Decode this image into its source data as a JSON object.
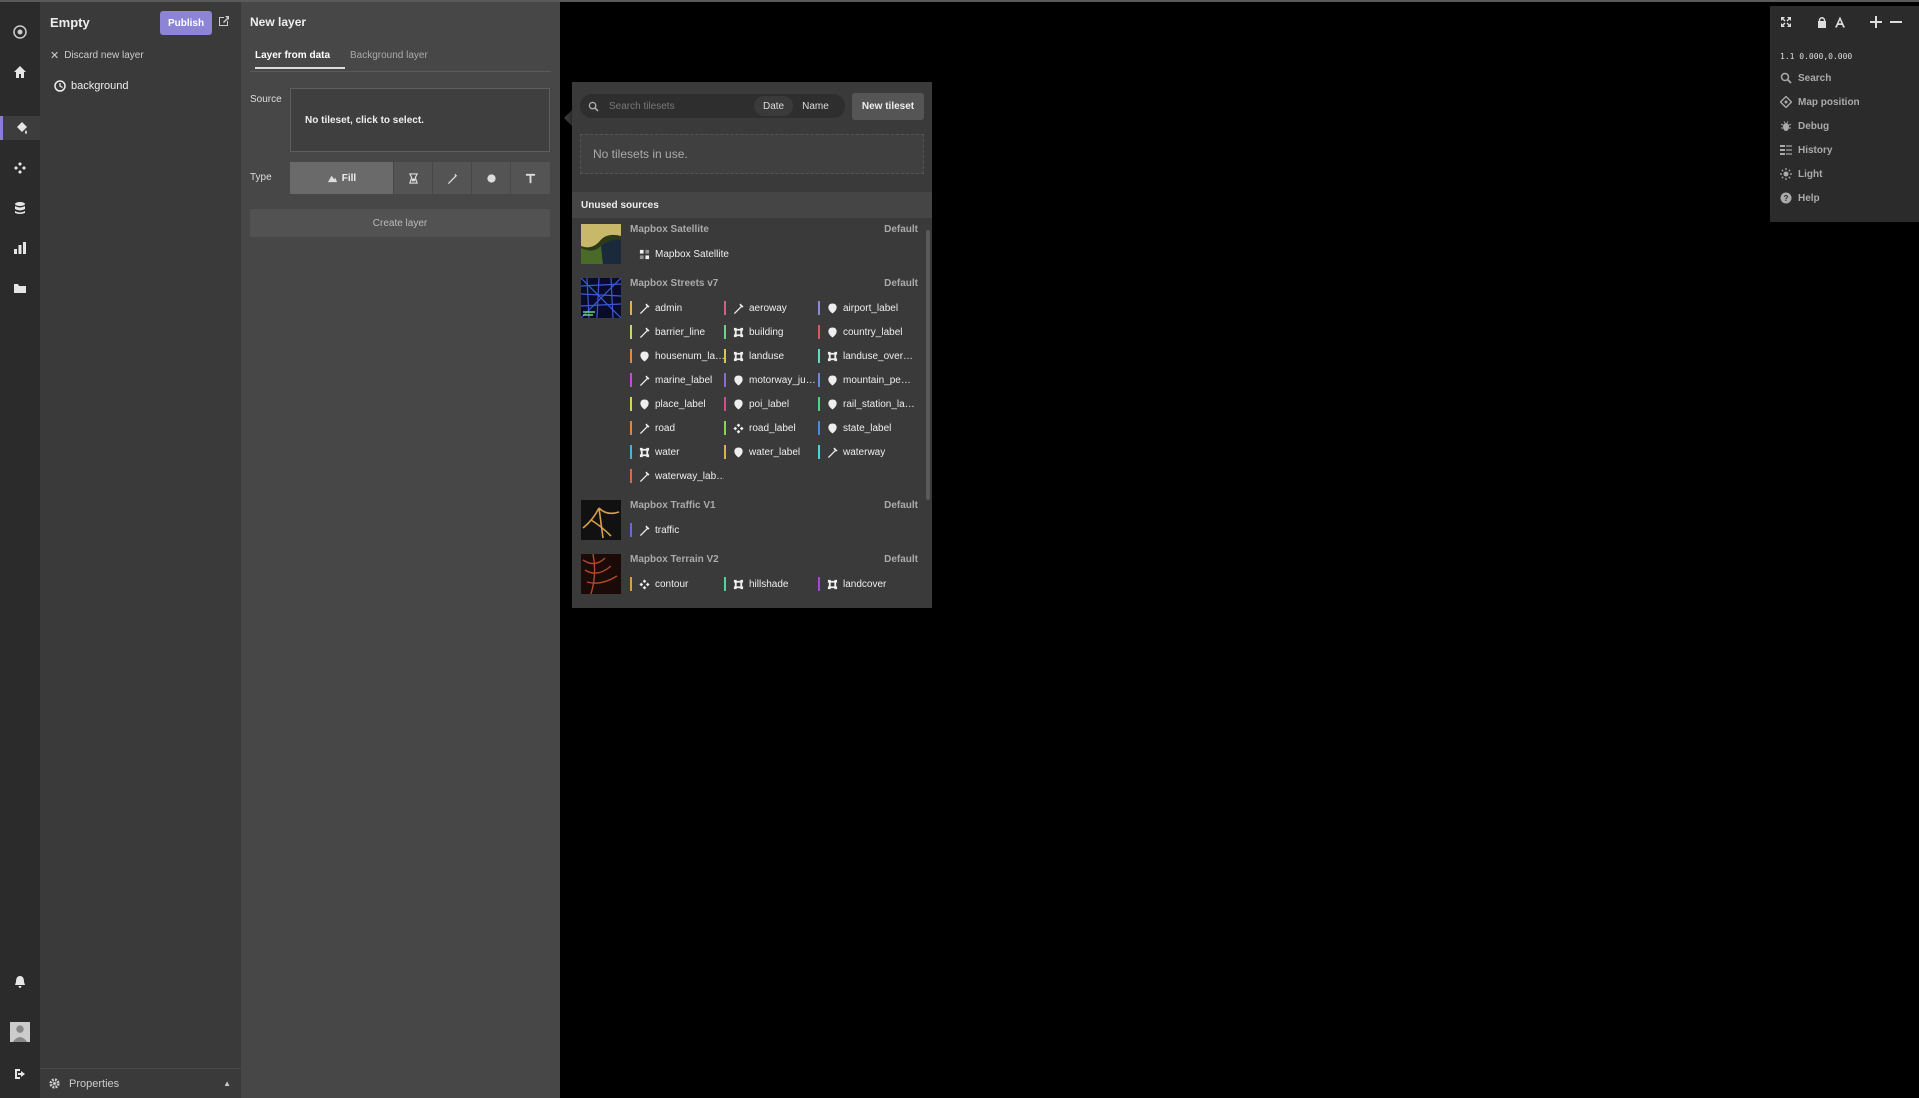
{
  "app": {
    "style_name": "Empty",
    "publish_label": "Publish"
  },
  "layers_panel": {
    "discard_label": "Discard new layer",
    "layers": [
      {
        "name": "background"
      }
    ],
    "properties_label": "Properties"
  },
  "new_layer": {
    "title": "New layer",
    "tabs": [
      {
        "label": "Layer from data",
        "active": true
      },
      {
        "label": "Background layer",
        "active": false
      }
    ],
    "source_label": "Source",
    "source_value": "No tileset, click to select.",
    "type_label": "Type",
    "types": [
      {
        "label": "Fill",
        "icon": "fill-icon",
        "active": true
      },
      {
        "label": "",
        "icon": "fill-extrusion-icon"
      },
      {
        "label": "",
        "icon": "line-icon"
      },
      {
        "label": "",
        "icon": "circle-icon"
      },
      {
        "label": "",
        "icon": "symbol-icon"
      }
    ],
    "create_label": "Create layer"
  },
  "tileset_picker": {
    "search_placeholder": "Search tilesets",
    "sort_options": [
      "Date",
      "Name"
    ],
    "sort_selected": "Date",
    "new_tileset_label": "New tileset",
    "empty_message": "No tilesets in use.",
    "unused_heading": "Unused sources",
    "sources": [
      {
        "name": "Mapbox Satellite",
        "badge": "Default",
        "layers": [
          {
            "name": "Mapbox Satellite",
            "icon": "raster-icon",
            "color": "#3a3a3a"
          }
        ]
      },
      {
        "name": "Mapbox Streets v7",
        "badge": "Default",
        "layers": [
          {
            "name": "admin",
            "icon": "line-icon",
            "color": "#e0b34a"
          },
          {
            "name": "aeroway",
            "icon": "line-icon",
            "color": "#d65a8a"
          },
          {
            "name": "airport_label",
            "icon": "point-icon",
            "color": "#8a8ad6"
          },
          {
            "name": "barrier_line",
            "icon": "line-icon",
            "color": "#c8d66a"
          },
          {
            "name": "building",
            "icon": "polygon-icon",
            "color": "#6ad68a"
          },
          {
            "name": "country_label",
            "icon": "point-icon",
            "color": "#d65a5a"
          },
          {
            "name": "housenum_la…",
            "icon": "point-icon",
            "color": "#e08a4a"
          },
          {
            "name": "landuse",
            "icon": "polygon-icon",
            "color": "#d6c84a"
          },
          {
            "name": "landuse_over…",
            "icon": "polygon-icon",
            "color": "#6ad6c8"
          },
          {
            "name": "marine_label",
            "icon": "line-icon",
            "color": "#c84ad6"
          },
          {
            "name": "motorway_ju…",
            "icon": "point-icon",
            "color": "#8a6ad6"
          },
          {
            "name": "mountain_pe…",
            "icon": "point-icon",
            "color": "#6a8ad6"
          },
          {
            "name": "place_label",
            "icon": "point-icon",
            "color": "#d6d64a"
          },
          {
            "name": "poi_label",
            "icon": "point-icon",
            "color": "#d64a8a"
          },
          {
            "name": "rail_station_la…",
            "icon": "point-icon",
            "color": "#4ad68a"
          },
          {
            "name": "road",
            "icon": "line-icon",
            "color": "#d68a4a"
          },
          {
            "name": "road_label",
            "icon": "line-label-icon",
            "color": "#8ad64a"
          },
          {
            "name": "state_label",
            "icon": "point-icon",
            "color": "#4a8ad6"
          },
          {
            "name": "water",
            "icon": "polygon-icon",
            "color": "#4ab4d6"
          },
          {
            "name": "water_label",
            "icon": "point-icon",
            "color": "#d6b44a"
          },
          {
            "name": "waterway",
            "icon": "line-icon",
            "color": "#4ad6d6"
          },
          {
            "name": "waterway_lab…",
            "icon": "line-icon",
            "color": "#d66a4a"
          }
        ]
      },
      {
        "name": "Mapbox Traffic V1",
        "badge": "Default",
        "layers": [
          {
            "name": "traffic",
            "icon": "line-icon",
            "color": "#6a6ad6"
          }
        ]
      },
      {
        "name": "Mapbox Terrain V2",
        "badge": "Default",
        "layers": [
          {
            "name": "contour",
            "icon": "line-label-icon",
            "color": "#d6a04a"
          },
          {
            "name": "hillshade",
            "icon": "polygon-icon",
            "color": "#4ad6a0"
          },
          {
            "name": "landcover",
            "icon": "polygon-icon",
            "color": "#a04ad6"
          }
        ]
      }
    ]
  },
  "map_controls": {
    "coords": "1.1 0.000,0.000",
    "items": [
      {
        "label": "Search",
        "icon": "search-icon"
      },
      {
        "label": "Map position",
        "icon": "crosshair-icon"
      },
      {
        "label": "Debug",
        "icon": "bug-icon"
      },
      {
        "label": "History",
        "icon": "history-icon"
      },
      {
        "label": "Light",
        "icon": "light-icon"
      },
      {
        "label": "Help",
        "icon": "help-icon"
      }
    ]
  },
  "colors": {
    "accent": "#8e84d6",
    "panel": "#474747",
    "sidebar": "#3a3a3a",
    "rail": "#2b2b2b"
  }
}
